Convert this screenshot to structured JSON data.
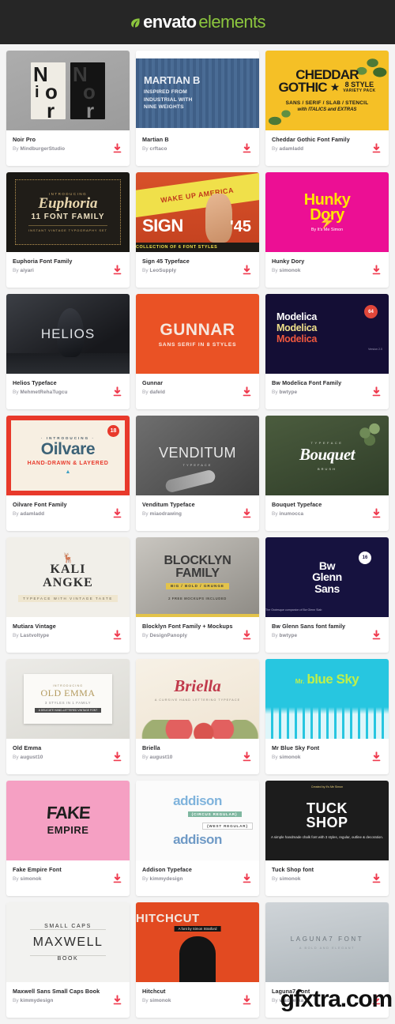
{
  "header": {
    "logo_primary": "envato",
    "logo_secondary": "elements",
    "leaf_icon": "leaf-icon",
    "bg_color": "#262626",
    "accent_color": "#8cc63e"
  },
  "watermark": {
    "text": "gfxtra.com"
  },
  "card_ui": {
    "by_prefix": "By ",
    "download_icon": "download-icon",
    "download_color": "#ef3a4e"
  },
  "items": [
    {
      "title": "Noir Pro",
      "author": "MindburgerStudio",
      "thumb": {
        "style": "noir",
        "sheet_letters": [
          "N",
          "i",
          "o",
          "r"
        ]
      }
    },
    {
      "title": "Martian B",
      "author": "crftaco",
      "thumb": {
        "style": "martian",
        "line1": "MARTIAN B",
        "line2": "INSPIRED FROM",
        "line3": "INDUSTRIAL WITH",
        "line4": "NINE WEIGHTS"
      }
    },
    {
      "title": "Cheddar Gothic Font Family",
      "author": "adamladd",
      "thumb": {
        "style": "cheddar",
        "line1": "CHEDDAR",
        "line2": "GOTHIC",
        "star": "★",
        "styles_count": "8 STYLE",
        "variety": "VARIETY PACK",
        "categories": "SANS / SERIF / SLAB / STENCIL",
        "extras": "with ITALICS and EXTRAS"
      }
    },
    {
      "title": "Euphoria Font Family",
      "author": "aiyari",
      "thumb": {
        "style": "euphoria",
        "intro": "INTRODUCING",
        "name": "Euphoria",
        "family": "11 FONT FAMILY",
        "tagline": "INSTANT VINTAGE TYPOGRAPHY SET"
      }
    },
    {
      "title": "Sign 45 Typeface",
      "author": "LeoSupply",
      "thumb": {
        "style": "sign45",
        "banner": "WAKE UP AMERICA",
        "big": "SIGN",
        "num": "'45",
        "foot": "COLLECTION OF 6 FONT STYLES"
      }
    },
    {
      "title": "Hunky Dory",
      "author": "simonok",
      "thumb": {
        "style": "hunky",
        "line1": "Hunky",
        "line2": "Dory",
        "by": "By It's Me Simon"
      }
    },
    {
      "title": "Helios Typeface",
      "author": "MehmetRehaTugcu",
      "thumb": {
        "style": "helios",
        "line1": "HELIOS"
      }
    },
    {
      "title": "Gunnar",
      "author": "dafeld",
      "thumb": {
        "style": "gunnar",
        "line1": "GUNNAR",
        "line2": "SANS SERIF IN 8 STYLES"
      }
    },
    {
      "title": "Bw Modelica Font Family",
      "author": "bwtype",
      "thumb": {
        "style": "modelica",
        "m1": "Modelica",
        "m2": "Modelica",
        "m3": "Modelica",
        "badge": "64",
        "version": "Version 2.0"
      }
    },
    {
      "title": "Oilvare Font Family",
      "author": "adamladd",
      "thumb": {
        "style": "oilvare",
        "intro": "· INTRODUCING ·",
        "name": "Oilvare",
        "tagline": "HAND-DRAWN & LAYERED",
        "badge": "18"
      }
    },
    {
      "title": "Venditum Typeface",
      "author": "miaodrawing",
      "thumb": {
        "style": "venditum",
        "line1": "VENDITUM",
        "line2": "TYPEFACE"
      }
    },
    {
      "title": "Bouquet Typeface",
      "author": "inumocca",
      "thumb": {
        "style": "bouquet",
        "top": "TYPEFACE",
        "name": "Bouquet",
        "bottom": "BRUSH"
      }
    },
    {
      "title": "Mutiara Vintage",
      "author": "Lastvoltype",
      "thumb": {
        "style": "kali",
        "deer_icon": "deer-head-icon",
        "line1": "KALI",
        "line2": "ANGKE",
        "tagline": "TYPEFACE WITH VINTAGE TASTE"
      }
    },
    {
      "title": "Blocklyn Font Family + Mockups",
      "author": "DesignPanoply",
      "thumb": {
        "style": "blocklyn",
        "line1": "BLOCKLYN",
        "line2": "FAMILY",
        "weights": "BIG / BOLD / GRUNGE",
        "foot": "2 FREE MOCKUPS INCLUDED"
      }
    },
    {
      "title": "Bw Glenn Sans font family",
      "author": "bwtype",
      "thumb": {
        "style": "bwglenn",
        "line1": "Bw",
        "line2": "Glenn",
        "line3": "Sans",
        "badge": "16",
        "foot": "The Grotesque companion of Bw Glenn Slab"
      }
    },
    {
      "title": "Old Emma",
      "author": "august10",
      "thumb": {
        "style": "oldemma",
        "intro": "INTRODUCING",
        "name": "OLD EMMA",
        "styles": "3 STYLES IN 1 FAMILY",
        "foot": "A DELICATE HAND-LETTERED VINTAGE FONT"
      }
    },
    {
      "title": "Briella",
      "author": "august10",
      "thumb": {
        "style": "briella",
        "name": "Briella",
        "tagline": "A CURSIVE HAND LETTERING TYPEFACE"
      }
    },
    {
      "title": "Mr Blue Sky Font",
      "author": "simonok",
      "thumb": {
        "style": "mrblue",
        "mr": "Mr.",
        "name": "blue Sky"
      }
    },
    {
      "title": "Fake Empire Font",
      "author": "simonok",
      "thumb": {
        "style": "fake",
        "line1": "FAKE",
        "line2": "EMPIRE"
      }
    },
    {
      "title": "Addison Typeface",
      "author": "kimmydesign",
      "thumb": {
        "style": "addison",
        "name_top": "addison",
        "name_bottom": "addison",
        "pill_top": "{CIRCUS REGULAR}",
        "pill_bottom": "{WEST REGULAR}"
      }
    },
    {
      "title": "Tuck Shop font",
      "author": "simonok",
      "thumb": {
        "style": "tuck",
        "created_by": "Created by It's Me Simon",
        "line1": "TUCK",
        "line2": "SHOP",
        "tagline": "A simple handmade chalk font with 3 styles, regular, outline & decoration."
      }
    },
    {
      "title": "Maxwell Sans Small Caps Book",
      "author": "kimmydesign",
      "thumb": {
        "style": "maxwell",
        "line1": "SMALL CAPS",
        "line2": "MAXWELL",
        "line3": "BOOK"
      }
    },
    {
      "title": "Hitchcut",
      "author": "simonok",
      "thumb": {
        "style": "hitch",
        "line1": "HITCHCUT",
        "tagline": "A font by Simon Stratford"
      }
    },
    {
      "title": "Laguna7 Font",
      "author": "vladderka",
      "thumb": {
        "style": "laguna",
        "line1": "LAGUNA7 FONT",
        "line2": "A BOLD AND ELEGANT"
      }
    }
  ]
}
